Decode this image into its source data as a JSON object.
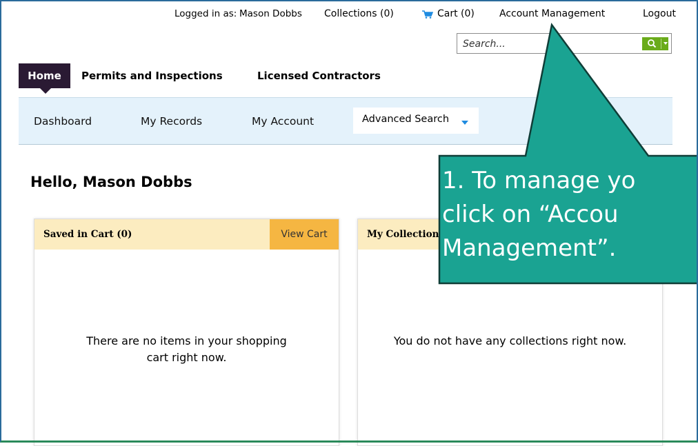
{
  "toplinks": {
    "logged_in_label": "Logged in as:",
    "user_name": "Mason Dobbs",
    "collections": "Collections (0)",
    "cart": "Cart (0)",
    "account_management": "Account Management",
    "logout": "Logout"
  },
  "search": {
    "placeholder": "Search..."
  },
  "tabs": [
    {
      "label": "Home",
      "active": true
    },
    {
      "label": "Permits and Inspections"
    },
    {
      "label": "Licensed Contractors"
    }
  ],
  "subnav": {
    "items": [
      "Dashboard",
      "My Records",
      "My Account"
    ],
    "advanced_search": "Advanced Search"
  },
  "greeting": "Hello, Mason Dobbs",
  "panels": {
    "cart": {
      "title": "Saved in Cart (0)",
      "button": "View Cart",
      "empty_message": "There are no items in your shopping cart right now."
    },
    "collections": {
      "title": "My Collection",
      "empty_message": "You do not have any collections right now."
    }
  },
  "callout": {
    "lines": [
      "1. To manage yo",
      "click on “Accou",
      "Management”."
    ]
  },
  "colors": {
    "home_tab": "#2a1a33",
    "subnav_bg": "#e4f2fb",
    "panel_header": "#fcecc0",
    "view_cart_button": "#f5b642",
    "search_button": "#6aab1a",
    "callout_fill": "#1aa392",
    "callout_border": "#0f3d37"
  }
}
